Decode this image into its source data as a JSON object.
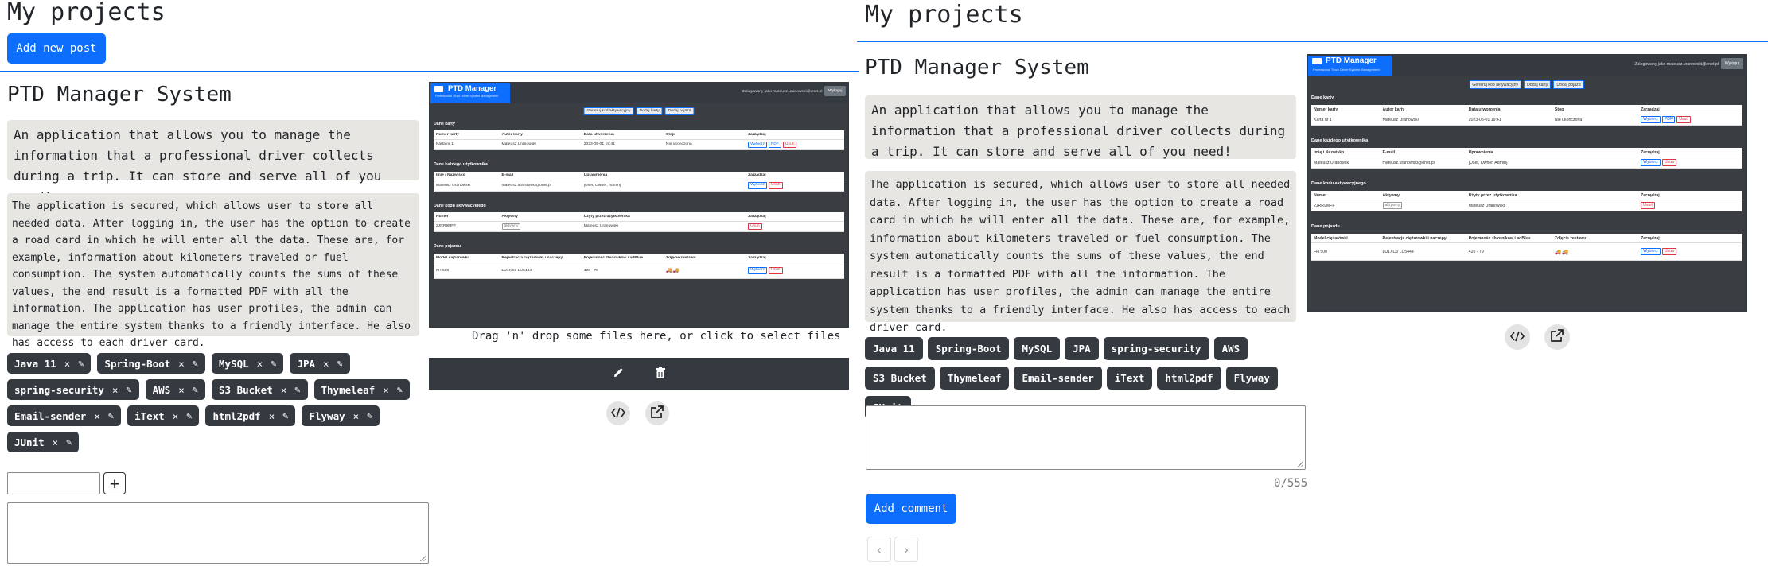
{
  "page": {
    "heading": "My projects",
    "add_post_label": "Add new post"
  },
  "project": {
    "title": "PTD Manager System",
    "lead": "An application that allows you to manage the information that a professional driver collects during a trip. It can store and serve all of you need!",
    "description": "The application is secured, which allows user to store all needed data. After logging in, the user has the option to create a road card in which he will enter all the data. These are, for example, information about kilometers traveled or fuel consumption. The system automatically counts the sums of these values, the end result is a formatted PDF with all the information. The application has user profiles, the admin can manage the entire system thanks to a friendly interface. He also has access to each driver card.",
    "tags": [
      "Java 11",
      "Spring-Boot",
      "MySQL",
      "JPA",
      "spring-security",
      "AWS",
      "S3 Bucket",
      "Thymeleaf",
      "Email-sender",
      "iText",
      "html2pdf",
      "Flyway",
      "JUnit"
    ]
  },
  "editor": {
    "tag_input_value": "",
    "add_tag_symbol": "+",
    "description_value": "",
    "dropzone_text": "Drag 'n' drop some files here, or click to select files"
  },
  "comments": {
    "input_value": "",
    "counter": "0/555",
    "add_comment_label": "Add comment",
    "prev_symbol": "‹",
    "next_symbol": "›"
  },
  "icons": {
    "tag_remove": "close-icon",
    "tag_edit": "pencil-icon",
    "image_edit": "pencil-icon",
    "image_delete": "trash-icon",
    "code": "code-icon",
    "external": "external-link-icon"
  },
  "colors": {
    "primary": "#0d6efd",
    "tag_bg": "#343a40",
    "box_bg": "#e8e6e3"
  },
  "preview": {
    "brand": "PTD Manager",
    "brand_sub": "Professional Truck Driver System Management",
    "logged_in": "Zalogowany jako mateusz.uranowski@onet.pl",
    "logout": "Wyloguj",
    "nav_buttons": [
      "Generuj kod aktywacyjny",
      "Dodaj karty",
      "Dodaj pojazd"
    ],
    "sections": [
      {
        "title": "Dane karty",
        "headers": [
          "Numer karty",
          "Autor karty",
          "Data utworzenia",
          "Stop",
          "Zarządzaj"
        ],
        "row": [
          "Karta nr 1",
          "Mateusz Uranowski",
          "2023-05-01 19:41",
          "Nie ukończona",
          ""
        ],
        "actions": [
          "Wybierz",
          "PDF",
          "Usuń"
        ]
      },
      {
        "title": "Dane każdego użytkownika",
        "headers": [
          "Imię i Nazwisko",
          "E-mail",
          "Uprawnienia",
          "",
          "Zarządzaj"
        ],
        "row": [
          "Mateusz Uranowski",
          "mateusz.uranowski@onet.pl",
          "[User, Owner, Admin]",
          "",
          ""
        ],
        "actions": [
          "Wybierz",
          "Usuń"
        ]
      },
      {
        "title": "Dane kodu aktywacyjnego",
        "headers": [
          "Numer",
          "Aktywny",
          "Użyty przez użytkownika",
          "",
          "Zarządzaj"
        ],
        "row": [
          "2JRR9MFF",
          "aktywny",
          "Mateusz Uranowski",
          "",
          ""
        ],
        "actions": [
          "Usuń"
        ]
      },
      {
        "title": "Dane pojazdu",
        "headers": [
          "Model ciężarówki",
          "Rejestracja ciężarówki i naczepy",
          "Pojemność zbiorników i adBlue",
          "Zdjęcie zestawu",
          "Zarządzaj"
        ],
        "row": [
          "FH 500",
          "LU1XC3 LU5444",
          "420 - 79",
          "",
          ""
        ],
        "actions": [
          "Wybierz",
          "Usuń"
        ]
      }
    ]
  }
}
